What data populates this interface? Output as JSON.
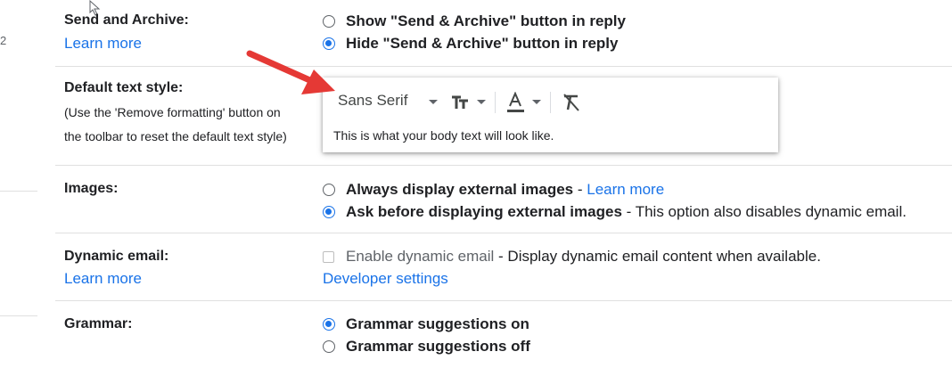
{
  "edge": {
    "number": "2"
  },
  "send_archive": {
    "label": "Send and Archive:",
    "learn_more": "Learn more",
    "options": [
      {
        "label": "Show \"Send & Archive\" button in reply",
        "selected": false
      },
      {
        "label": "Hide \"Send & Archive\" button in reply",
        "selected": true
      }
    ]
  },
  "default_text": {
    "label": "Default text style:",
    "hint_line1": "(Use the 'Remove formatting' button on",
    "hint_line2": "the toolbar to reset the default text style)",
    "font": "Sans Serif",
    "preview": "This is what your body text will look like."
  },
  "images": {
    "label": "Images:",
    "options": [
      {
        "label": "Always display external images",
        "sep": " - ",
        "link": "Learn more",
        "selected": false
      },
      {
        "label": "Ask before displaying external images",
        "rest": " - This option also disables dynamic email.",
        "selected": true
      }
    ]
  },
  "dynamic": {
    "label": "Dynamic email:",
    "learn_more": "Learn more",
    "checkbox_label": "Enable dynamic email",
    "checkbox_rest": " - Display dynamic email content when available.",
    "developer": "Developer settings"
  },
  "grammar": {
    "label": "Grammar:",
    "options": [
      {
        "label": "Grammar suggestions on",
        "selected": true
      },
      {
        "label": "Grammar suggestions off",
        "selected": false
      }
    ]
  },
  "colors": {
    "accent": "#1a73e8",
    "arrow": "#e53935"
  }
}
